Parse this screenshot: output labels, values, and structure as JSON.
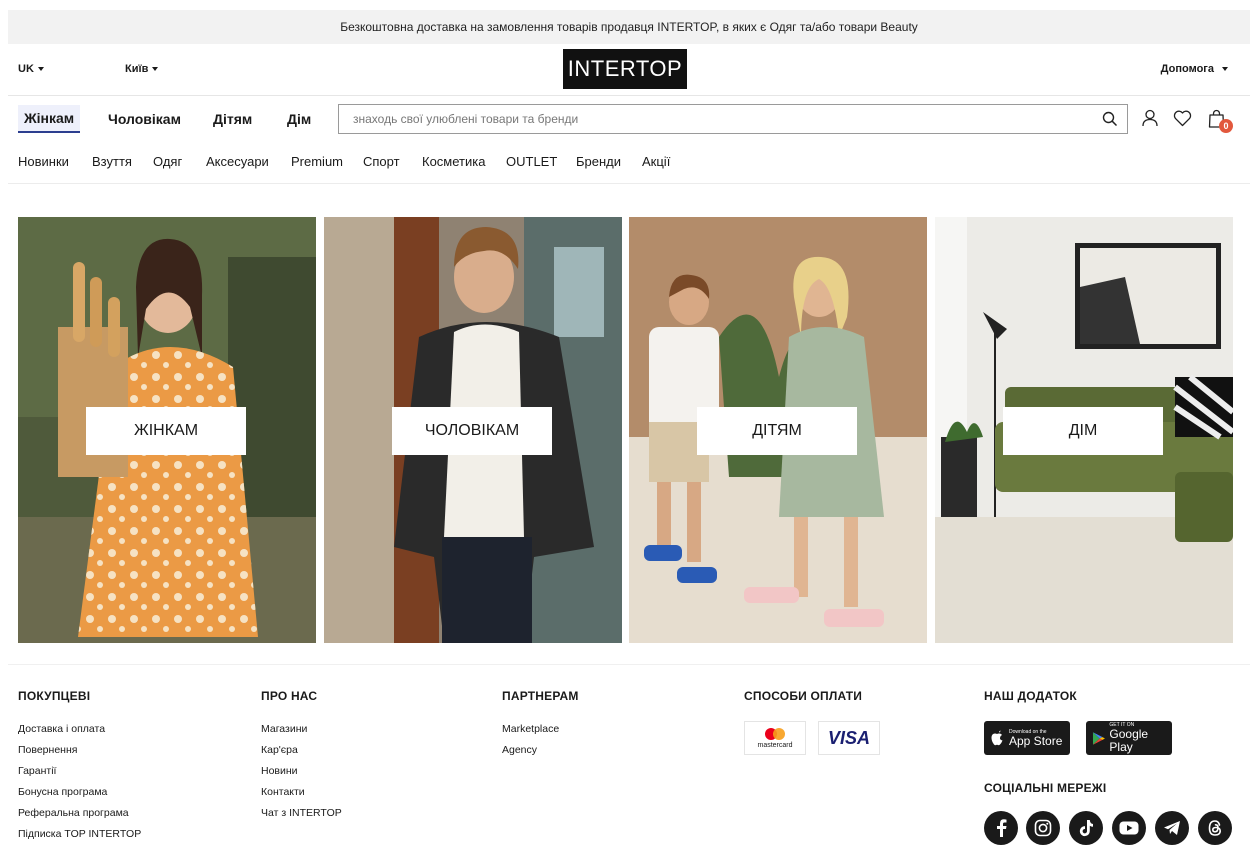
{
  "promo": {
    "text": "Безкоштовна доставка на замовлення товарів продавця INTERTOP, в яких є Одяг та/або товари Beauty"
  },
  "header": {
    "language": "UK",
    "city": "Київ",
    "logo": "INTERTOP",
    "help": "Допомога"
  },
  "nav": {
    "tabs": [
      {
        "label": "Жінкам",
        "active": true
      },
      {
        "label": "Чоловікам",
        "active": false
      },
      {
        "label": "Дітям",
        "active": false
      },
      {
        "label": "Дім",
        "active": false
      }
    ],
    "search_placeholder": "знаходь свої улюблені товари та бренди",
    "cart_count": "0",
    "icons": [
      "search-icon",
      "user-icon",
      "heart-icon",
      "bag-icon"
    ]
  },
  "subnav": {
    "items": [
      "Новинки",
      "Взуття",
      "Одяг",
      "Аксесуари",
      "Premium",
      "Спорт",
      "Косметика",
      "OUTLET",
      "Бренди",
      "Акції"
    ]
  },
  "tiles": [
    {
      "label": "ЖІНКАМ"
    },
    {
      "label": "ЧОЛОВІКАМ"
    },
    {
      "label": "ДІТЯМ"
    },
    {
      "label": "ДІМ"
    }
  ],
  "footer": {
    "buyers": {
      "title": "ПОКУПЦЕВІ",
      "links": [
        "Доставка і оплата",
        "Повернення",
        "Гарантії",
        "Бонусна програма",
        "Реферальна програма",
        "Підписка TOP INTERTOP"
      ]
    },
    "about": {
      "title": "ПРО НАС",
      "links": [
        "Магазини",
        "Кар'єра",
        "Новини",
        "Контакти",
        "Чат з INTERTOP"
      ]
    },
    "partners": {
      "title": "ПАРТНЕРАМ",
      "links": [
        "Marketplace",
        "Agency"
      ]
    },
    "payment": {
      "title": "СПОСОБИ ОПЛАТИ",
      "mastercard": "mastercard",
      "visa": "VISA"
    },
    "app": {
      "title": "НАШ ДОДАТОК",
      "appstore_small": "Download on the",
      "appstore_big": "App Store",
      "googleplay_small": "GET IT ON",
      "googleplay_big": "Google Play"
    },
    "social": {
      "title": "СОЦІАЛЬНІ МЕРЕЖІ",
      "icons": [
        "facebook-icon",
        "instagram-icon",
        "tiktok-icon",
        "youtube-icon",
        "telegram-icon",
        "threads-icon"
      ]
    }
  }
}
